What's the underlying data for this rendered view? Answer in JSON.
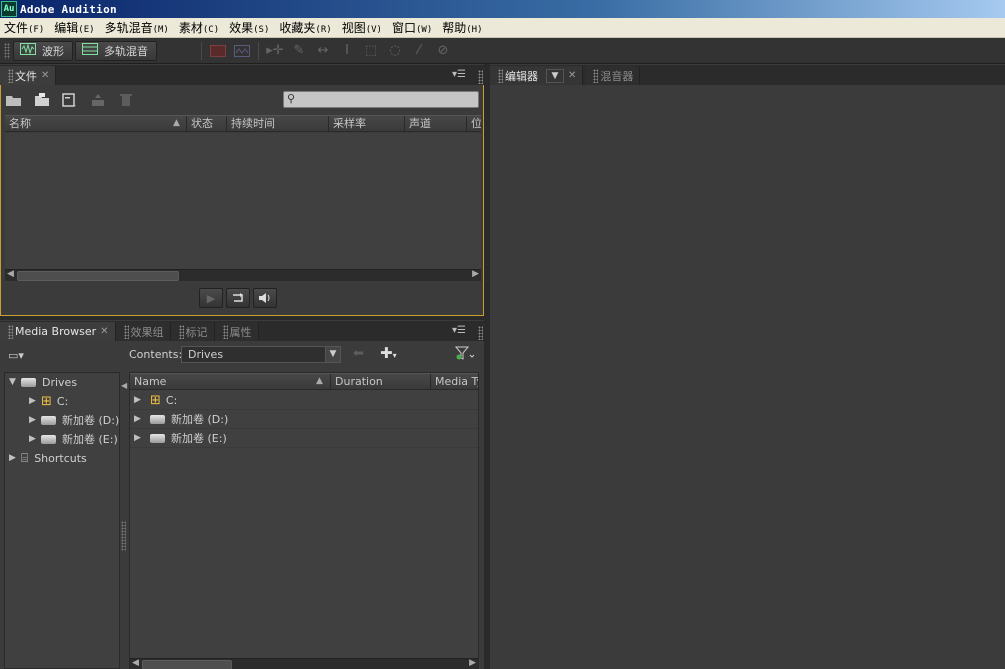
{
  "window": {
    "icon_text": "Au",
    "title": "Adobe Audition"
  },
  "menu": [
    {
      "label": "文件",
      "acc": "(F)"
    },
    {
      "label": "编辑",
      "acc": "(E)"
    },
    {
      "label": "多轨混音",
      "acc": "(M)"
    },
    {
      "label": "素材",
      "acc": "(C)"
    },
    {
      "label": "效果",
      "acc": "(S)"
    },
    {
      "label": "收藏夹",
      "acc": "(R)"
    },
    {
      "label": "视图",
      "acc": "(V)"
    },
    {
      "label": "窗口",
      "acc": "(W)"
    },
    {
      "label": "帮助",
      "acc": "(H)"
    }
  ],
  "toolbar": {
    "waveform_label": "波形",
    "multitrack_label": "多轨混音"
  },
  "files_panel": {
    "tab_label": "文件",
    "columns": [
      "名称",
      "状态",
      "持续时间",
      "采样率",
      "声道",
      "位"
    ]
  },
  "editor": {
    "tab_editor": "编辑器",
    "tab_mixer": "混音器"
  },
  "media_browser": {
    "tabs": [
      "Media Browser",
      "效果组",
      "标记",
      "属性"
    ],
    "contents_label": "Contents:",
    "contents_value": "Drives",
    "tree": {
      "root": "Drives",
      "drives": [
        "C:",
        "新加卷 (D:)",
        "新加卷 (E:)"
      ],
      "shortcuts": "Shortcuts"
    },
    "columns": [
      "Name",
      "Duration",
      "Media Ty"
    ],
    "items": [
      "C:",
      "新加卷 (D:)",
      "新加卷 (E:)"
    ]
  },
  "colors": {
    "active_panel_border": "#c8a030",
    "background": "#3b3b3b"
  }
}
